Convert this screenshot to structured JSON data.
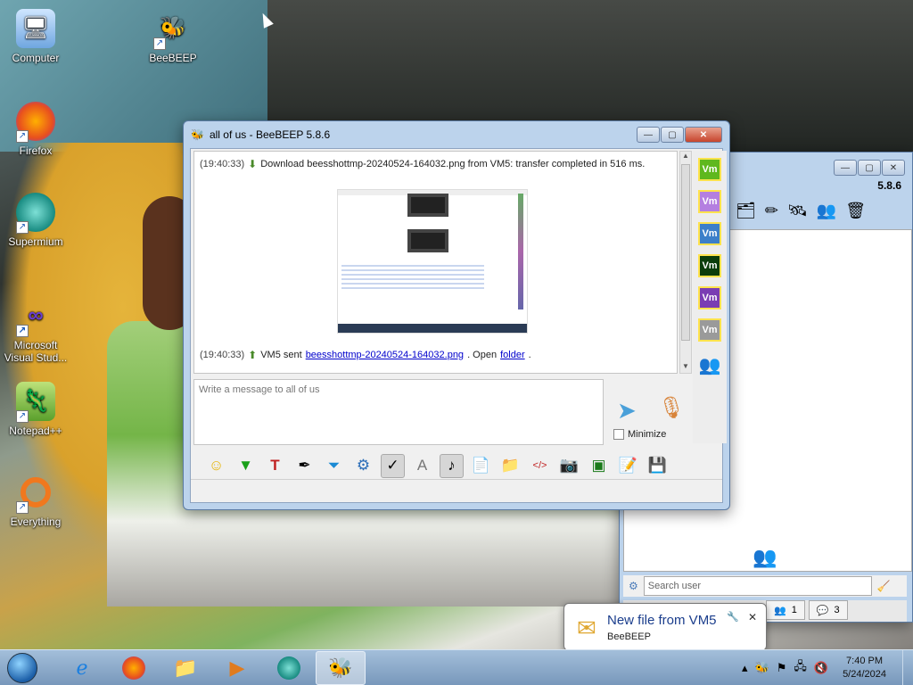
{
  "desktop": {
    "icons": [
      {
        "label": "Computer",
        "icon": "computer-icon"
      },
      {
        "label": "BeeBEEP",
        "icon": "bee-icon"
      },
      {
        "label": "Firefox",
        "icon": "firefox-icon"
      },
      {
        "label": "Supermium",
        "icon": "supermium-icon"
      },
      {
        "label": "Microsoft Visual Stud...",
        "icon": "visual-studio-icon"
      },
      {
        "label": "Notepad++",
        "icon": "notepad-plus-plus-icon"
      },
      {
        "label": "Everything",
        "icon": "everything-search-icon"
      }
    ]
  },
  "chat_window": {
    "title": "all of us - BeeBEEP 5.8.6",
    "messages": [
      {
        "time": "(19:40:33)",
        "text": "Download beesshottmp-20240524-164032.png from VM5: transfer completed in 516 ms."
      },
      {
        "time": "(19:40:33)",
        "prefix": "VM5 sent ",
        "link": "beesshottmp-20240524-164032.png",
        "middle": ". Open ",
        "link2": "folder",
        "suffix": "."
      }
    ],
    "input_placeholder": "Write a message to all of us",
    "minimize_label": "Minimize",
    "users": [
      {
        "label": "Vm",
        "color": "#5fb81e"
      },
      {
        "label": "Vm",
        "color": "#b47fe0"
      },
      {
        "label": "Vm",
        "color": "#3c7fc9"
      },
      {
        "label": "Vm",
        "color": "#0b3d0b"
      },
      {
        "label": "Vm",
        "color": "#7a3db3"
      },
      {
        "label": "Vm",
        "color": "#9a9a9a"
      }
    ],
    "toolbar_icons": [
      "emoji-icon",
      "arrow-down-icon",
      "text-format-icon",
      "color-pen-icon",
      "filter-icon",
      "settings-icon",
      "spellcheck-icon",
      "font-icon",
      "music-note-icon",
      "send-file-icon",
      "send-folder-icon",
      "code-icon",
      "screenshot-icon",
      "photo-icon",
      "edit-note-icon",
      "save-icon"
    ]
  },
  "main_window": {
    "version": "5.8.6",
    "search_placeholder": "Search user",
    "tab1_count": "1",
    "tab2_count": "3"
  },
  "notification": {
    "title": "New file from VM5",
    "subtitle": "BeeBEEP"
  },
  "taskbar": {
    "time": "7:40 PM",
    "date": "5/24/2024"
  }
}
